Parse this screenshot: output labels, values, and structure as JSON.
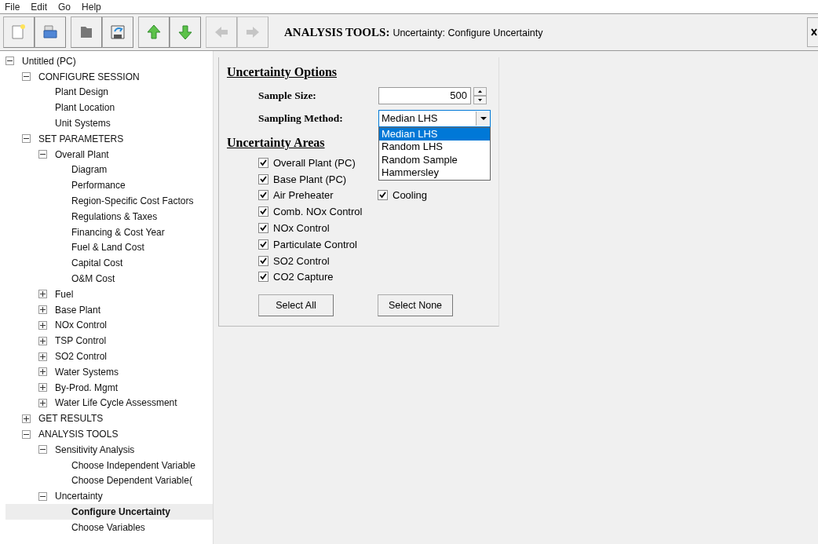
{
  "menu": [
    "File",
    "Edit",
    "Go",
    "Help"
  ],
  "toolbar": {
    "buttons": [
      {
        "disabled": false
      },
      {
        "disabled": false
      },
      {
        "disabled": false
      },
      {
        "disabled": false
      },
      {
        "disabled": false
      },
      {
        "disabled": false
      },
      {
        "disabled": true
      },
      {
        "disabled": true
      }
    ],
    "title_bold": "ANALYSIS TOOLS:",
    "title": "Uncertainty: Configure Uncertainty"
  },
  "tree": [
    {
      "label": "Untitled (PC)",
      "expanded": true,
      "children": [
        {
          "label": "CONFIGURE SESSION",
          "expanded": true,
          "children": [
            {
              "label": "Plant Design",
              "selected": false
            },
            {
              "label": "Plant Location",
              "selected": false
            },
            {
              "label": "Unit Systems",
              "selected": false
            }
          ]
        },
        {
          "label": "SET PARAMETERS",
          "expanded": true,
          "children": [
            {
              "label": "Overall Plant",
              "expanded": true,
              "children": [
                {
                  "label": "Diagram",
                  "selected": false
                },
                {
                  "label": "Performance",
                  "selected": false
                },
                {
                  "label": "Region-Specific Cost Factors",
                  "selected": false
                },
                {
                  "label": "Regulations & Taxes",
                  "selected": false
                },
                {
                  "label": "Financing & Cost Year",
                  "selected": false
                },
                {
                  "label": "Fuel & Land Cost",
                  "selected": false
                },
                {
                  "label": "Capital Cost",
                  "selected": false
                },
                {
                  "label": "O&M Cost",
                  "selected": false
                }
              ]
            },
            {
              "label": "Fuel",
              "expanded": false
            },
            {
              "label": "Base Plant",
              "expanded": false
            },
            {
              "label": "NOx Control",
              "expanded": false
            },
            {
              "label": "TSP Control",
              "expanded": false
            },
            {
              "label": "SO2 Control",
              "expanded": false
            },
            {
              "label": "Water Systems",
              "expanded": false
            },
            {
              "label": "By-Prod. Mgmt",
              "expanded": false
            },
            {
              "label": "Water Life Cycle Assessment",
              "expanded": false
            }
          ]
        },
        {
          "label": "GET RESULTS",
          "expanded": false
        },
        {
          "label": "ANALYSIS TOOLS",
          "expanded": true,
          "children": [
            {
              "label": "Sensitivity Analysis",
              "expanded": true,
              "children": [
                {
                  "label": "Choose Independent Variable",
                  "selected": false
                },
                {
                  "label": "Choose Dependent Variable(",
                  "selected": false
                }
              ]
            },
            {
              "label": "Uncertainty",
              "expanded": true,
              "children": [
                {
                  "label": "Configure Uncertainty",
                  "selected": true
                },
                {
                  "label": "Choose Variables",
                  "selected": false
                }
              ]
            }
          ]
        }
      ]
    }
  ],
  "options": {
    "heading": "Uncertainty Options",
    "sample_size_label": "Sample Size:",
    "sample_size": "500",
    "method_label": "Sampling Method:",
    "method": "Median LHS",
    "dropdown_open": true,
    "methods": [
      {
        "label": "Median LHS",
        "selected": true
      },
      {
        "label": "Random LHS",
        "selected": false
      },
      {
        "label": "Random Sample",
        "selected": false
      },
      {
        "label": "Hammersley",
        "selected": false
      }
    ]
  },
  "areas": {
    "heading": "Uncertainty Areas",
    "left": [
      {
        "label": "Overall Plant (PC)",
        "checked": true
      },
      {
        "label": "Base Plant (PC)",
        "checked": true
      },
      {
        "label": "Air Preheater",
        "checked": true
      },
      {
        "label": "Comb. NOx Control",
        "checked": true
      },
      {
        "label": "NOx Control",
        "checked": true
      },
      {
        "label": "Particulate Control",
        "checked": true
      },
      {
        "label": "SO2 Control",
        "checked": true
      },
      {
        "label": "CO2 Capture",
        "checked": true
      }
    ],
    "right": [
      {
        "label": "Cooling",
        "checked": true
      }
    ]
  },
  "buttons": [
    "Select All",
    "Select None"
  ]
}
